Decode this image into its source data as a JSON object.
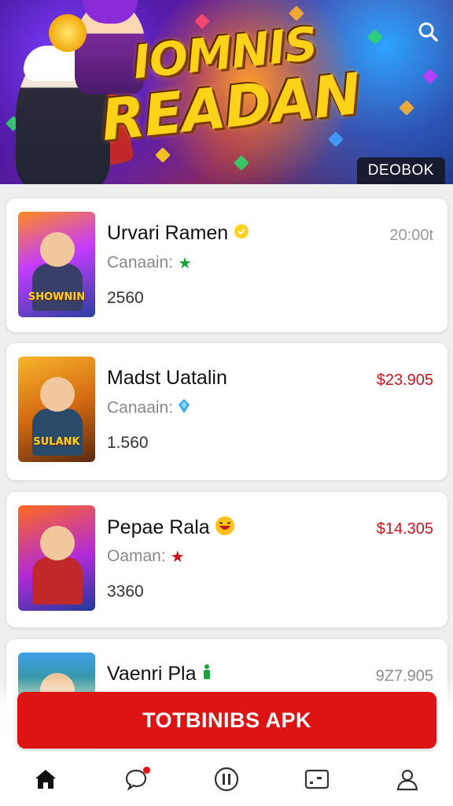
{
  "banner": {
    "title_line1": "IOMNIS",
    "title_line2": "READAN",
    "badge": "DEOBOK",
    "search_icon": "search-icon"
  },
  "games": [
    {
      "name": "Urvari Ramen",
      "sub": "Canaain:",
      "count": "2560",
      "price": "20:00t",
      "price_color": "#9a9a9a",
      "name_icon": "coin-icon",
      "sub_icon": "green-star-icon",
      "thumb_logo": "SHOWNIN"
    },
    {
      "name": "Madst Uatalin",
      "sub": "Canaain:",
      "count": "1.560",
      "price": "$23.905",
      "price_color": "#c4161c",
      "name_icon": "",
      "sub_icon": "blue-gem-icon",
      "thumb_logo": "SULANK"
    },
    {
      "name": "Pepae Rala",
      "sub": "Oaman:",
      "count": "3360",
      "price": "$14.305",
      "price_color": "#c4161c",
      "name_icon": "laughing-emoji-icon",
      "sub_icon": "red-star-icon",
      "thumb_logo": ""
    },
    {
      "name": "Vaenri Pla",
      "sub": "",
      "count": "",
      "price": "9Z7.905",
      "price_color": "#8a8a8a",
      "name_icon": "green-figure-icon",
      "sub_icon": "",
      "thumb_logo": ""
    }
  ],
  "cta": {
    "label": "TOTBINIBS APK"
  },
  "nav": [
    {
      "icon": "home-icon",
      "active": true
    },
    {
      "icon": "chat-icon",
      "active": false,
      "has_dot": true
    },
    {
      "icon": "pause-circle-icon",
      "active": false
    },
    {
      "icon": "card-icon",
      "active": false
    },
    {
      "icon": "profile-icon",
      "active": false
    }
  ],
  "colors": {
    "accent": "#de1414",
    "price_red": "#c4161c",
    "title_gold": "#ffd21a"
  }
}
